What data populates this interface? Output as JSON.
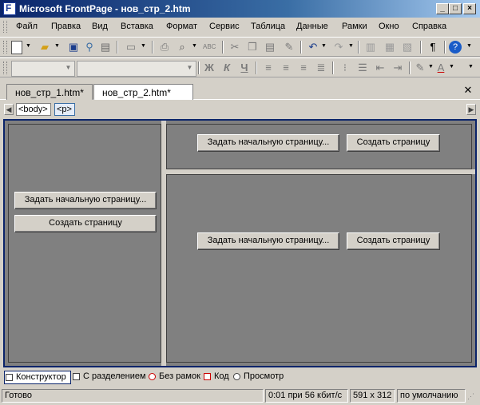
{
  "window": {
    "title": "Microsoft FrontPage - нов_стр_2.htm"
  },
  "menu": [
    "Файл",
    "Правка",
    "Вид",
    "Вставка",
    "Формат",
    "Сервис",
    "Таблица",
    "Данные",
    "Рамки",
    "Окно",
    "Справка"
  ],
  "tabs": [
    {
      "label": "нов_стр_1.htm*",
      "active": false
    },
    {
      "label": "нов_стр_2.htm*",
      "active": true
    }
  ],
  "quick_tags": [
    "<body>",
    "<p>"
  ],
  "frames": {
    "left": {
      "home_button": "Задать начальную страницу...",
      "create_button": "Создать страницу"
    },
    "top": {
      "home_button": "Задать начальную страницу...",
      "create_button": "Создать страницу"
    },
    "bottom": {
      "home_button": "Задать начальную страницу...",
      "create_button": "Создать страницу"
    }
  },
  "views": [
    "Конструктор",
    "С разделением",
    "Без рамок",
    "Код",
    "Просмотр"
  ],
  "status": {
    "ready": "Готово",
    "download": "0:01 при 56 кбит/с",
    "size": "591 x 312",
    "mode": "по умолчанию"
  },
  "format_toolbar": {
    "bold": "Ж",
    "italic": "К",
    "underline": "Ч",
    "font_color": "A"
  }
}
